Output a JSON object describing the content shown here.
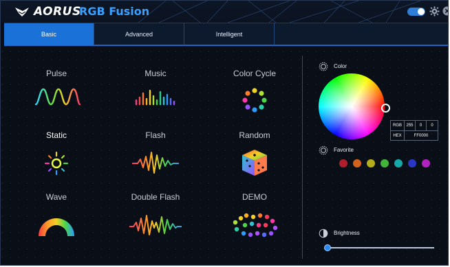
{
  "window": {
    "brand": "AORUS",
    "app_name": "RGB Fusion"
  },
  "titlebar": {
    "toggle_state": "on",
    "icons": [
      "toggle-switch",
      "gear-icon",
      "close-icon"
    ]
  },
  "tabs": [
    {
      "label": "Basic",
      "active": true
    },
    {
      "label": "Advanced",
      "active": false
    },
    {
      "label": "Intelligent",
      "active": false
    }
  ],
  "effects": [
    {
      "label": "Pulse",
      "icon": "pulse-wave-icon"
    },
    {
      "label": "Music",
      "icon": "music-bars-icon"
    },
    {
      "label": "Color Cycle",
      "icon": "color-cycle-dots-icon"
    },
    {
      "label": "Static",
      "icon": "static-sun-icon",
      "active": true
    },
    {
      "label": "Flash",
      "icon": "flash-wave-icon"
    },
    {
      "label": "Random",
      "icon": "random-dice-icon"
    },
    {
      "label": "Wave",
      "icon": "wave-rainbow-arc-icon"
    },
    {
      "label": "Double Flash",
      "icon": "double-flash-wave-icon"
    },
    {
      "label": "DEMO",
      "icon": "demo-dots-icon"
    }
  ],
  "color_section": {
    "title": "Color",
    "rgb_label": "RGB",
    "r": "255",
    "g": "0",
    "b": "0",
    "hex_label": "HEX",
    "hex": "FF0000"
  },
  "favorite_section": {
    "title": "Favorite",
    "colors": [
      "#b01d2b",
      "#d2621c",
      "#b5ad1a",
      "#42b43a",
      "#15a8a8",
      "#2a36c6",
      "#b022c2"
    ]
  },
  "brightness_section": {
    "title": "Brightness",
    "value": 0.0
  },
  "accent_color": "#1a72d8"
}
